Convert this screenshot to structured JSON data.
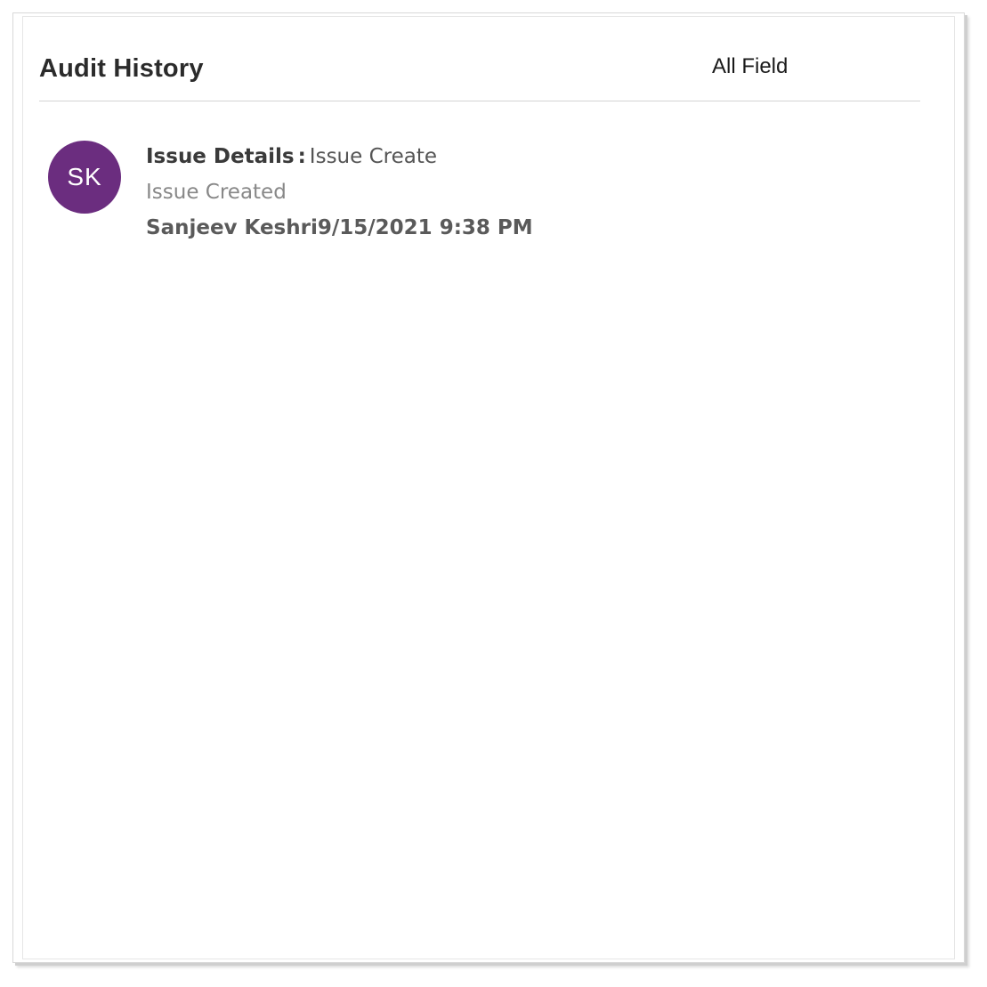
{
  "panel": {
    "title": "Audit History",
    "filter_label": "All Field"
  },
  "entries": [
    {
      "avatar_initials": "SK",
      "avatar_color": "#6b2d7f",
      "section": "Issue Details",
      "separator": ":",
      "action": "Issue Create",
      "description": "Issue Created",
      "user": "Sanjeev Keshri",
      "timestamp": "9/15/2021 9:38 PM"
    }
  ]
}
